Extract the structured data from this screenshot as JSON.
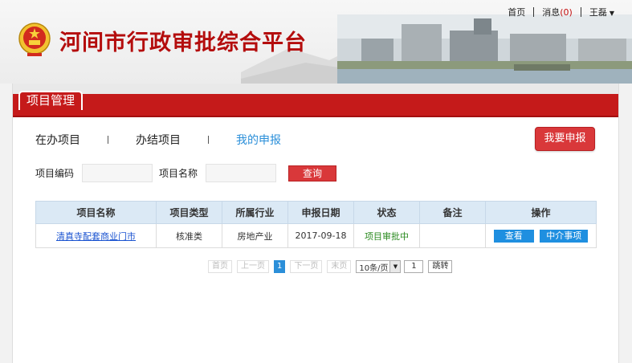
{
  "header": {
    "title": "河间市行政审批综合平台",
    "nav": {
      "home": "首页",
      "messages": "消息",
      "open_paren": "(",
      "message_count": "0",
      "close_paren": ")",
      "user": "王磊"
    }
  },
  "panel": {
    "active_tab": "项目管理",
    "subtabs": [
      "在办项目",
      "办结项目",
      "我的申报"
    ],
    "apply_button": "我要申报",
    "filters": {
      "code_label": "项目编码",
      "name_label": "项目名称",
      "search_button": "查询"
    }
  },
  "table": {
    "headers": [
      "项目名称",
      "项目类型",
      "所属行业",
      "申报日期",
      "状态",
      "备注",
      "操作"
    ],
    "rows": [
      {
        "name": "清真寺配套商业门市",
        "type": "核准类",
        "industry": "房地产业",
        "date": "2017-09-18",
        "status": "项目审批中",
        "note": "",
        "actions": [
          "查看",
          "中介事项"
        ]
      }
    ]
  },
  "pager": {
    "first": "首页",
    "prev": "上一页",
    "current": "1",
    "next": "下一页",
    "last": "末页",
    "page_size": "10条/页",
    "page_input": "1",
    "go": "跳转"
  },
  "colors": {
    "brand_red": "#c51a1a",
    "link_blue": "#2b8fd9",
    "status_green": "#2a8a1f"
  }
}
